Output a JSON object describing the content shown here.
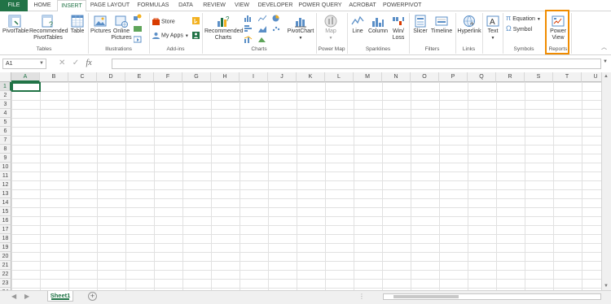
{
  "tabs": [
    "FILE",
    "HOME",
    "INSERT",
    "PAGE LAYOUT",
    "FORMULAS",
    "DATA",
    "REVIEW",
    "VIEW",
    "DEVELOPER",
    "POWER QUERY",
    "ACROBAT",
    "POWERPIVOT"
  ],
  "ribbon": {
    "pivottable": "PivotTable",
    "recommended_pivottables": [
      "Recommended",
      "PivotTables"
    ],
    "table": "Table",
    "pictures": "Pictures",
    "online_pictures": [
      "Online",
      "Pictures"
    ],
    "store": "Store",
    "my_apps": "My Apps",
    "recommended_charts": [
      "Recommended",
      "Charts"
    ],
    "pivotchart": "PivotChart",
    "map": "Map",
    "line": "Line",
    "column": "Column",
    "winloss": [
      "Win/",
      "Loss"
    ],
    "slicer": "Slicer",
    "timeline": "Timeline",
    "hyperlink": "Hyperlink",
    "text": "Text",
    "equation": "Equation",
    "symbol": "Symbol",
    "power_view": [
      "Power",
      "View"
    ]
  },
  "groups": {
    "tables": "Tables",
    "illustrations": "Illustrations",
    "addins": "Add-ins",
    "charts": "Charts",
    "power_map": "Power Map",
    "sparklines": "Sparklines",
    "filters": "Filters",
    "links": "Links",
    "symbols": "Symbols",
    "reports": "Reports"
  },
  "formula_bar": {
    "name_box": "A1",
    "fx": "fx",
    "value": ""
  },
  "columns": [
    "A",
    "B",
    "C",
    "D",
    "E",
    "F",
    "G",
    "H",
    "I",
    "J",
    "K",
    "L",
    "M",
    "N",
    "O",
    "P",
    "Q",
    "R",
    "S",
    "T",
    "U"
  ],
  "rows": [
    "1",
    "2",
    "3",
    "4",
    "5",
    "6",
    "7",
    "8",
    "9",
    "10",
    "11",
    "12",
    "13",
    "14",
    "15",
    "16",
    "17",
    "18",
    "19",
    "20",
    "21",
    "22",
    "23",
    "24"
  ],
  "active_cell": "A1",
  "sheet": {
    "name": "Sheet1"
  },
  "colors": {
    "accent": "#217346",
    "highlight": "#f08c00"
  }
}
